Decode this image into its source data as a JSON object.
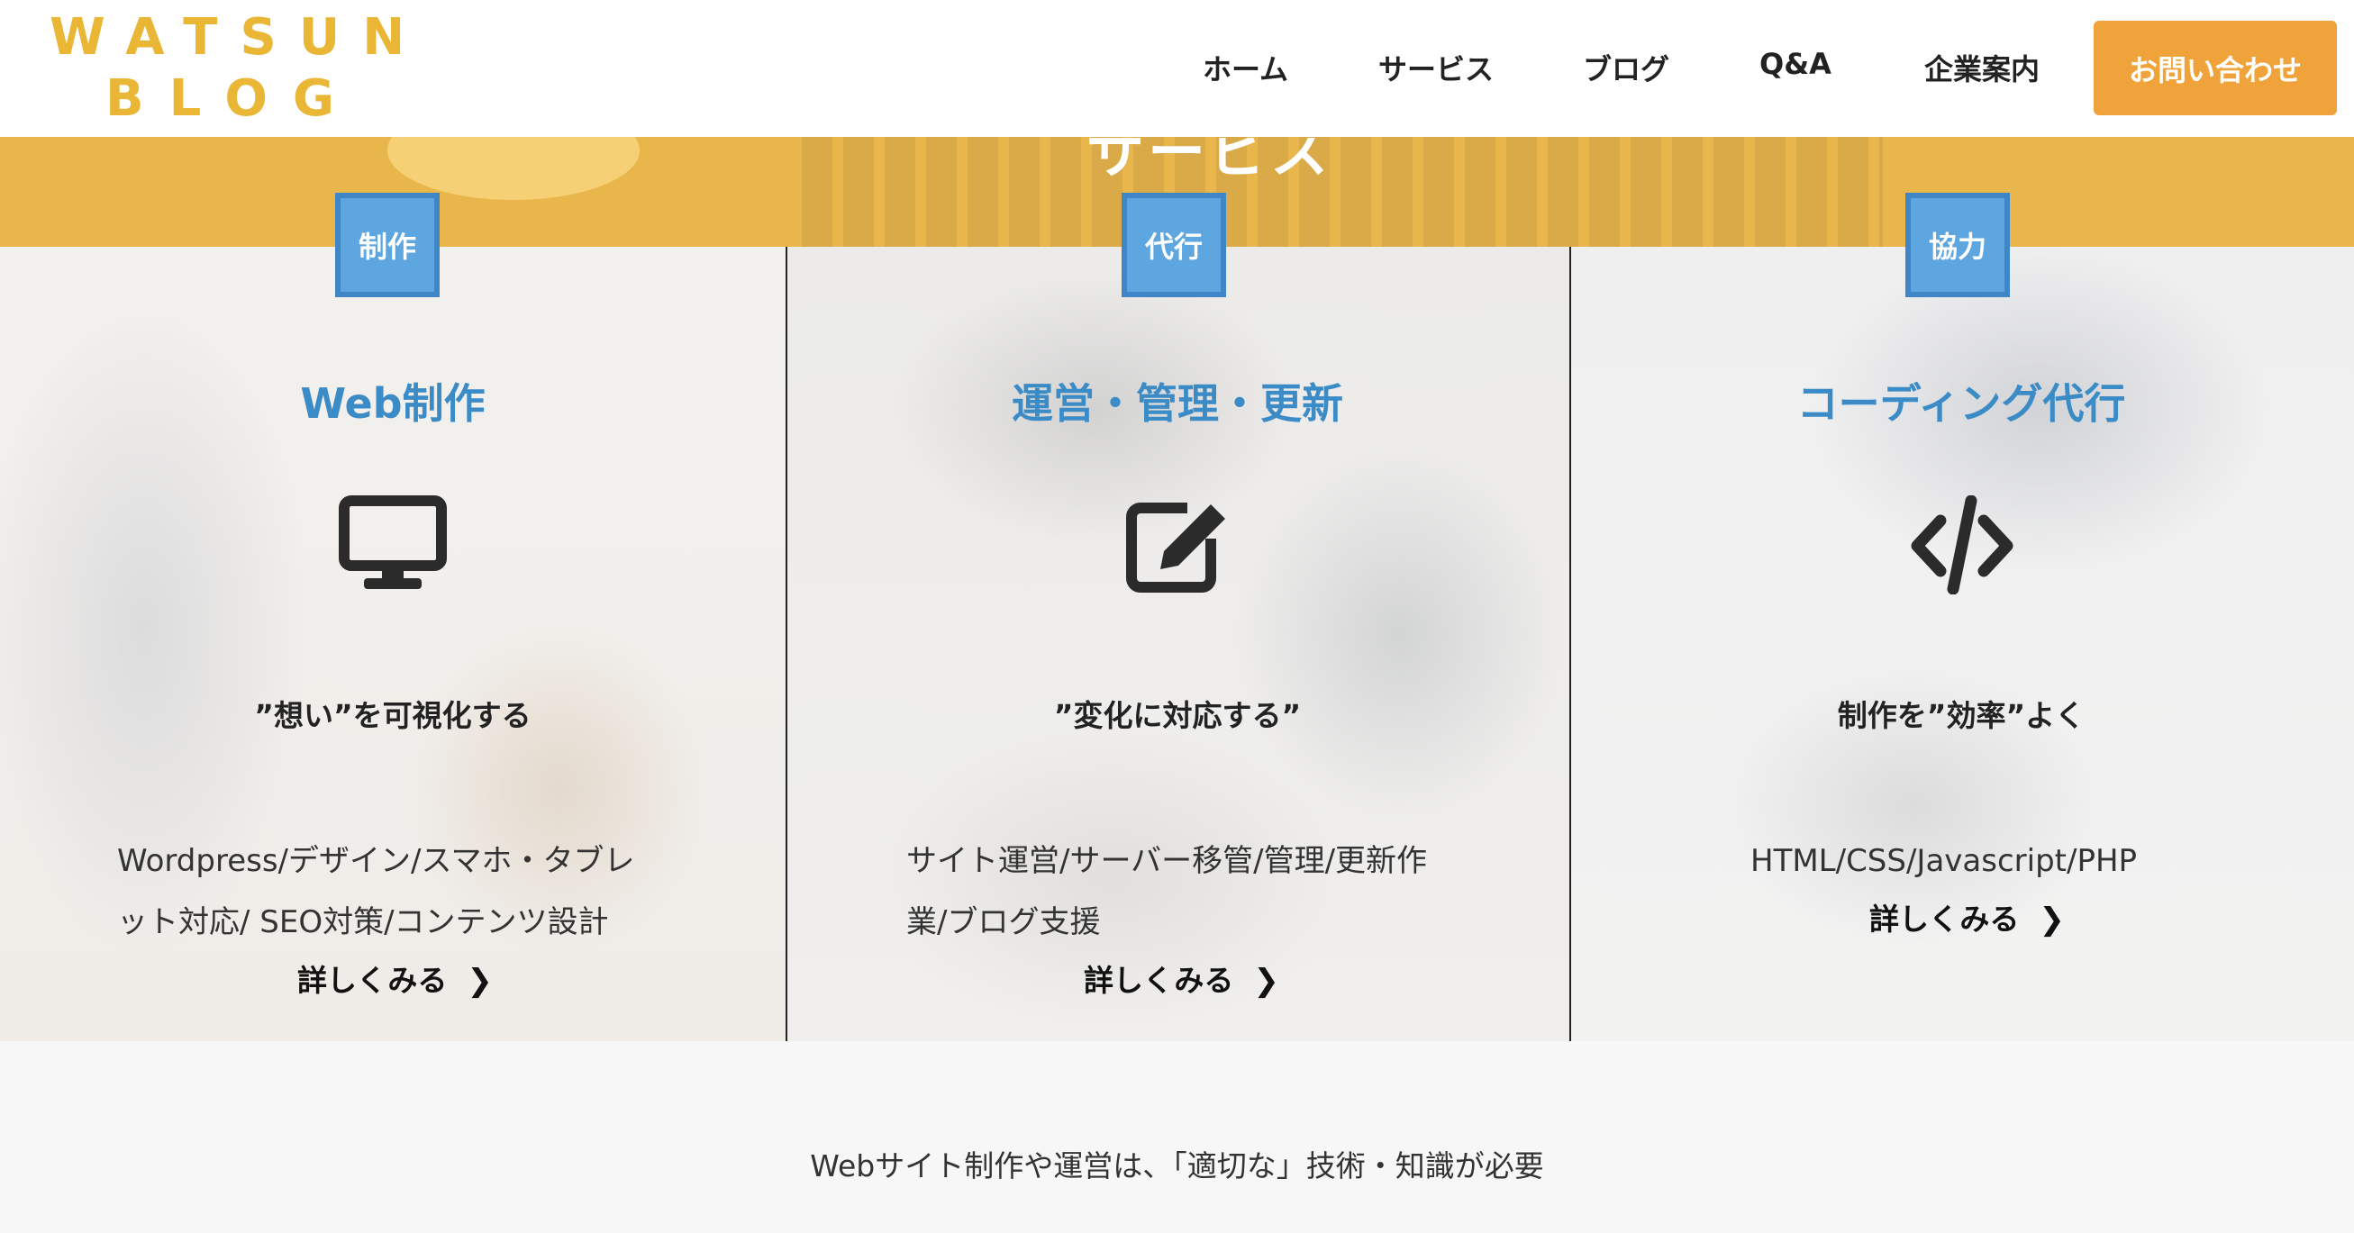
{
  "header": {
    "logo_line1": "WATSUN",
    "logo_line2": "BLOG",
    "nav": {
      "home": "ホーム",
      "service": "サービス",
      "blog": "ブログ",
      "qa": "Q&A",
      "company": "企業案内"
    },
    "contact_button": "お問い合わせ"
  },
  "hero": {
    "title": "サービス"
  },
  "services": [
    {
      "badge": "制作",
      "title": "Web制作",
      "icon": "desktop-monitor-icon",
      "tagline": "”想い”を可視化する",
      "desc_line1": "Wordpress/デザイン/スマホ・タブレ",
      "desc_line2": "ット対応/ SEO対策/コンテンツ設計",
      "more": "詳しくみる"
    },
    {
      "badge": "代行",
      "title": "運営・管理・更新",
      "icon": "edit-pencil-icon",
      "tagline": "”変化に対応する”",
      "desc_line1": "サイト運営/サーバー移管/管理/更新作",
      "desc_line2": "業/ブログ支援",
      "more": "詳しくみる"
    },
    {
      "badge": "協力",
      "title": "コーディング代行",
      "icon": "code-brackets-icon",
      "tagline": "制作を”効率”よく",
      "desc_line1": "HTML/CSS/Javascript/PHP",
      "more": "詳しくみる"
    }
  ],
  "footer": {
    "text": "Webサイト制作や運営は、「適切な」技術・知識が必要"
  },
  "colors": {
    "brand_yellow": "#e9b636",
    "cta_orange": "#f0a33a",
    "badge_blue": "#5da6df",
    "title_blue": "#3b8bc7"
  }
}
